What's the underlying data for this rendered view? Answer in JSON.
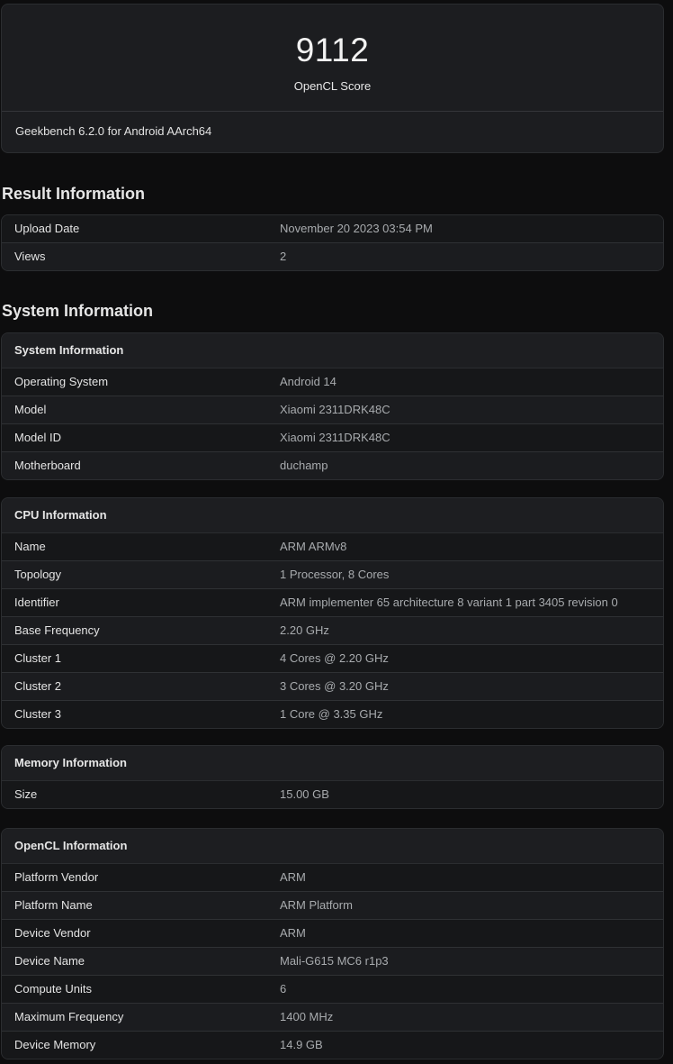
{
  "score": {
    "value": "9112",
    "label": "OpenCL Score",
    "version": "Geekbench 6.2.0 for Android AArch64"
  },
  "result_information": {
    "heading": "Result Information",
    "rows": [
      {
        "key": "Upload Date",
        "value": "November 20 2023 03:54 PM"
      },
      {
        "key": "Views",
        "value": "2"
      }
    ]
  },
  "system_information": {
    "heading": "System Information",
    "card_title": "System Information",
    "rows": [
      {
        "key": "Operating System",
        "value": "Android 14"
      },
      {
        "key": "Model",
        "value": "Xiaomi 2311DRK48C"
      },
      {
        "key": "Model ID",
        "value": "Xiaomi 2311DRK48C"
      },
      {
        "key": "Motherboard",
        "value": "duchamp"
      }
    ]
  },
  "cpu_information": {
    "card_title": "CPU Information",
    "rows": [
      {
        "key": "Name",
        "value": "ARM ARMv8"
      },
      {
        "key": "Topology",
        "value": "1 Processor, 8 Cores"
      },
      {
        "key": "Identifier",
        "value": "ARM implementer 65 architecture 8 variant 1 part 3405 revision 0"
      },
      {
        "key": "Base Frequency",
        "value": "2.20 GHz"
      },
      {
        "key": "Cluster 1",
        "value": "4 Cores @ 2.20 GHz"
      },
      {
        "key": "Cluster 2",
        "value": "3 Cores @ 3.20 GHz"
      },
      {
        "key": "Cluster 3",
        "value": "1 Core @ 3.35 GHz"
      }
    ]
  },
  "memory_information": {
    "card_title": "Memory Information",
    "rows": [
      {
        "key": "Size",
        "value": "15.00 GB"
      }
    ]
  },
  "opencl_information": {
    "card_title": "OpenCL Information",
    "rows": [
      {
        "key": "Platform Vendor",
        "value": "ARM"
      },
      {
        "key": "Platform Name",
        "value": "ARM Platform"
      },
      {
        "key": "Device Vendor",
        "value": "ARM"
      },
      {
        "key": "Device Name",
        "value": "Mali-G615 MC6 r1p3"
      },
      {
        "key": "Compute Units",
        "value": "6"
      },
      {
        "key": "Maximum Frequency",
        "value": "1400 MHz"
      },
      {
        "key": "Device Memory",
        "value": "14.9 GB"
      }
    ]
  }
}
